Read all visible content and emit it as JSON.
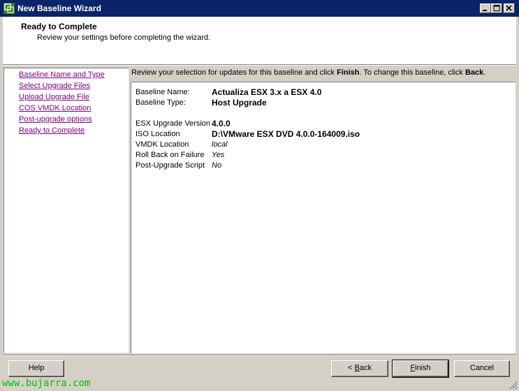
{
  "window": {
    "title": "New Baseline Wizard"
  },
  "header": {
    "title": "Ready to Complete",
    "subtitle": "Review your settings before completing the wizard."
  },
  "nav": {
    "items": [
      {
        "label": "Baseline Name and Type"
      },
      {
        "label": "Select Upgrade Files"
      },
      {
        "label": "Upload Upgrade File"
      },
      {
        "label": "COS VMDK Location"
      },
      {
        "label": "Post-upgrade options"
      },
      {
        "label": "Ready to Complete"
      }
    ]
  },
  "info": {
    "part1": "Review your selection for updates for this baseline and click ",
    "finish_word": "Finish",
    "part2": ". To change this baseline, click ",
    "back_word": "Back",
    "part3": "."
  },
  "summary": {
    "baseline_name_label": "Baseline Name:",
    "baseline_name_value": "Actualiza ESX 3.x a ESX 4.0",
    "baseline_type_label": "Baseline Type:",
    "baseline_type_value": "Host Upgrade",
    "esx_version_label": "ESX Upgrade Version",
    "esx_version_value": "4.0.0",
    "iso_location_label": "ISO Location",
    "iso_location_value": "D:\\VMware ESX DVD 4.0.0-164009.iso",
    "vmdk_location_label": "VMDK Location",
    "vmdk_location_value": "local",
    "rollback_label": "Roll Back on Failure",
    "rollback_value": "Yes",
    "post_script_label": "Post-Upgrade Script",
    "post_script_value": "No"
  },
  "buttons": {
    "help": "Help",
    "back_prefix": "< ",
    "back_accel": "B",
    "back_rest": "ack",
    "finish_accel": "F",
    "finish_rest": "inish",
    "cancel": "Cancel"
  },
  "watermark": "www.bujarra.com",
  "colors": {
    "titlebar": "#0a246a",
    "visited_link": "#800080",
    "dialog_bg": "#d4d0c8",
    "watermark": "#00c000"
  }
}
